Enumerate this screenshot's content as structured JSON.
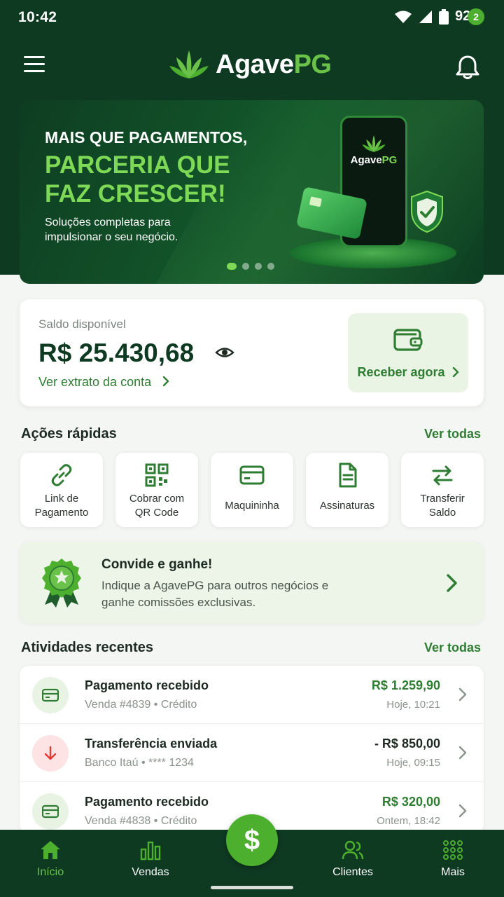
{
  "status_bar": {
    "time": "10:42",
    "battery": "92%"
  },
  "header": {
    "logo_main": "Agave",
    "logo_accent": "PG",
    "notification_count": "2"
  },
  "banner": {
    "line1": "MAIS QUE PAGAMENTOS,",
    "line2": "PARCERIA QUE FAZ CRESCER!",
    "subtitle": "Soluções completas para impulsionar o seu negócio.",
    "phone_logo_main": "Agave",
    "phone_logo_accent": "PG",
    "slides": 4,
    "active_slide": 1
  },
  "balance": {
    "label": "Saldo disponível",
    "value": "R$ 25.430,68",
    "statement_link": "Ver extrato da conta",
    "receive_button": "Receber agora"
  },
  "quick_actions": {
    "title": "Ações rápidas",
    "see_all": "Ver todas",
    "items": [
      {
        "label": "Link de\nPagamento",
        "icon": "link-icon"
      },
      {
        "label": "Cobrar com\nQR Code",
        "icon": "qr-code-icon"
      },
      {
        "label": "Maquininha",
        "icon": "card-machine-icon"
      },
      {
        "label": "Assinaturas",
        "icon": "document-icon"
      },
      {
        "label": "Transferir\nSaldo",
        "icon": "transfer-icon"
      }
    ]
  },
  "invite": {
    "title": "Convide e ganhe!",
    "text": "Indique a AgavePG para outros negócios e ganhe comissões exclusivas."
  },
  "recent": {
    "title": "Atividades recentes",
    "see_all": "Ver todas",
    "items": [
      {
        "title": "Pagamento recebido",
        "sub": "Venda #4839 • Crédito",
        "amount": "R$ 1.259,90",
        "time": "Hoje, 10:21",
        "type": "in"
      },
      {
        "title": "Transferência enviada",
        "sub": "Banco Itaú • **** 1234",
        "amount": "- R$ 850,00",
        "time": "Hoje, 09:15",
        "type": "out"
      },
      {
        "title": "Pagamento recebido",
        "sub": "Venda #4838 • Crédito",
        "amount": "R$ 320,00",
        "time": "Ontem, 18:42",
        "type": "in"
      }
    ]
  },
  "bottom_nav": {
    "items": [
      "Início",
      "Vendas",
      "Clientes",
      "Mais"
    ],
    "fab": "$"
  },
  "colors": {
    "brand_dark": "#0f3a22",
    "accent": "#4caf2e",
    "accent_light": "#7ed957"
  }
}
